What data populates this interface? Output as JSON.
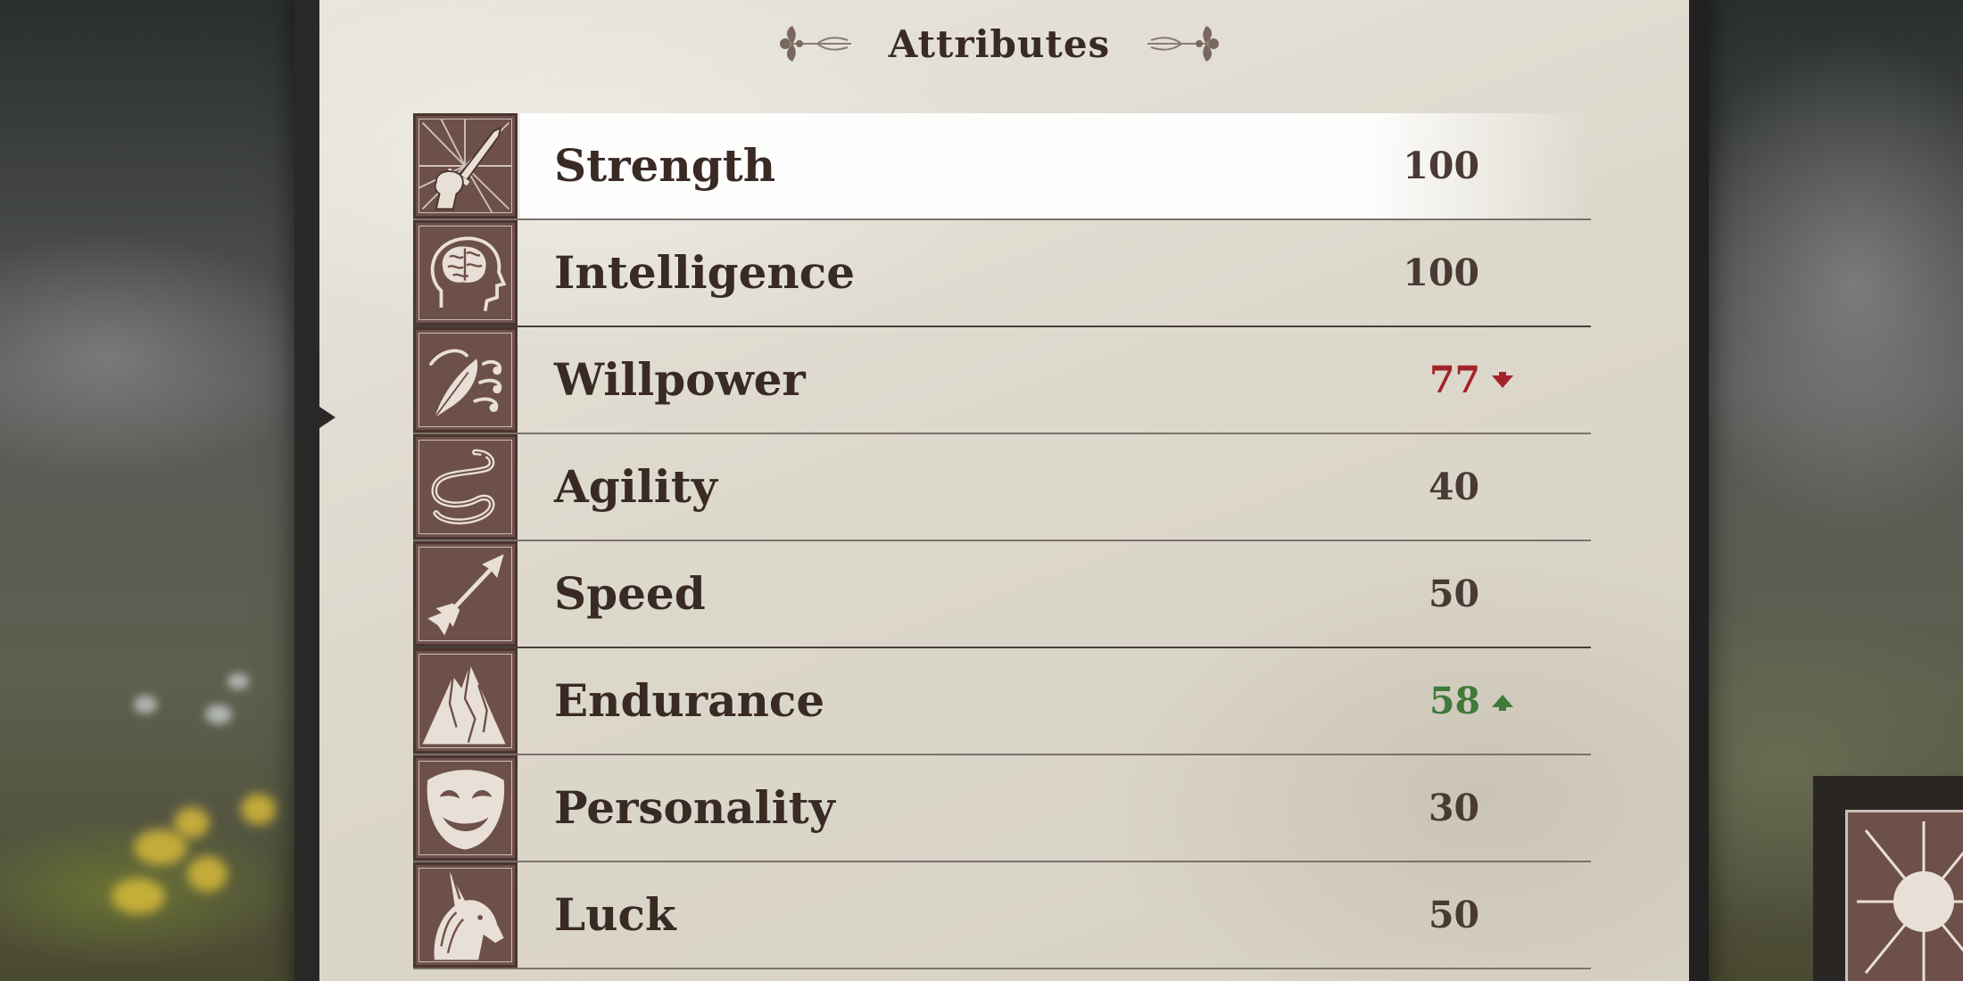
{
  "panel": {
    "title": "Attributes"
  },
  "attributes": [
    {
      "name": "Strength",
      "value": "100",
      "icon": "sword-fist-icon",
      "state": "selected",
      "delta": null
    },
    {
      "name": "Intelligence",
      "value": "100",
      "icon": "brain-head-icon",
      "state": "normal",
      "delta": null
    },
    {
      "name": "Willpower",
      "value": "77",
      "icon": "quill-wind-icon",
      "state": "normal",
      "delta": "down"
    },
    {
      "name": "Agility",
      "value": "40",
      "icon": "serpent-icon",
      "state": "normal",
      "delta": null
    },
    {
      "name": "Speed",
      "value": "50",
      "icon": "arrow-icon",
      "state": "normal",
      "delta": null
    },
    {
      "name": "Endurance",
      "value": "58",
      "icon": "mountain-icon",
      "state": "normal",
      "delta": "up"
    },
    {
      "name": "Personality",
      "value": "30",
      "icon": "theatre-mask-icon",
      "state": "normal",
      "delta": null
    },
    {
      "name": "Luck",
      "value": "50",
      "icon": "unicorn-icon",
      "state": "normal",
      "delta": null
    }
  ],
  "colors": {
    "ink": "#3a2a24",
    "decrease": "#a3232a",
    "increase": "#3f7a3a",
    "icon_bg": "#6e504a",
    "parchment": "#ddd8cc"
  }
}
